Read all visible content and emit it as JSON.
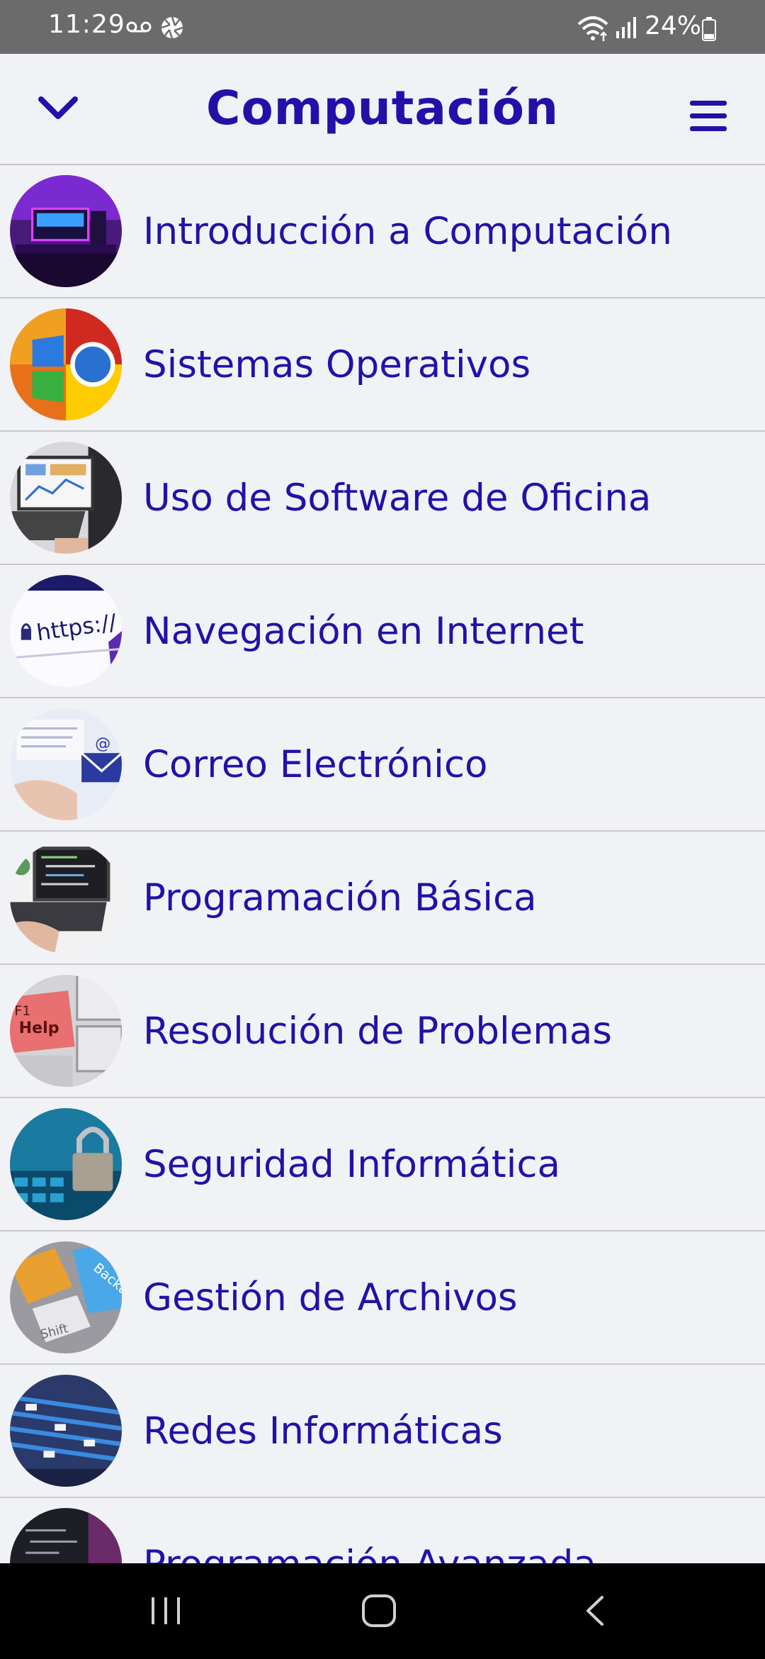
{
  "status_bar": {
    "time": "11:29",
    "battery": "24%",
    "icons": [
      "voicemail-icon",
      "shutter-icon",
      "wifi-icon",
      "signal-icon",
      "battery-icon"
    ]
  },
  "header": {
    "title": "Computación",
    "left_icon": "chevron-down-icon",
    "right_icon": "hamburger-menu-icon",
    "accent_color": "#2410a8"
  },
  "topics": [
    {
      "label": "Introducción a Computación",
      "thumb": "gaming-desk-thumbnail"
    },
    {
      "label": "Sistemas Operativos",
      "thumb": "os-logos-thumbnail"
    },
    {
      "label": "Uso de Software de Oficina",
      "thumb": "laptop-office-thumbnail"
    },
    {
      "label": "Navegación en Internet",
      "thumb": "https-url-thumbnail"
    },
    {
      "label": "Correo Electrónico",
      "thumb": "email-laptop-thumbnail"
    },
    {
      "label": "Programación Básica",
      "thumb": "coding-laptop-thumbnail"
    },
    {
      "label": "Resolución de Problemas",
      "thumb": "f1-help-key-thumbnail"
    },
    {
      "label": "Seguridad Informática",
      "thumb": "padlock-keyboard-thumbnail"
    },
    {
      "label": "Gestión de Archivos",
      "thumb": "backup-key-thumbnail"
    },
    {
      "label": "Redes Informáticas",
      "thumb": "network-cables-thumbnail"
    },
    {
      "label": "Programación Avanzada",
      "thumb": "code-screen-thumbnail"
    }
  ],
  "nav_bar": {
    "icons": [
      "recent-apps-icon",
      "home-icon",
      "back-icon"
    ]
  }
}
